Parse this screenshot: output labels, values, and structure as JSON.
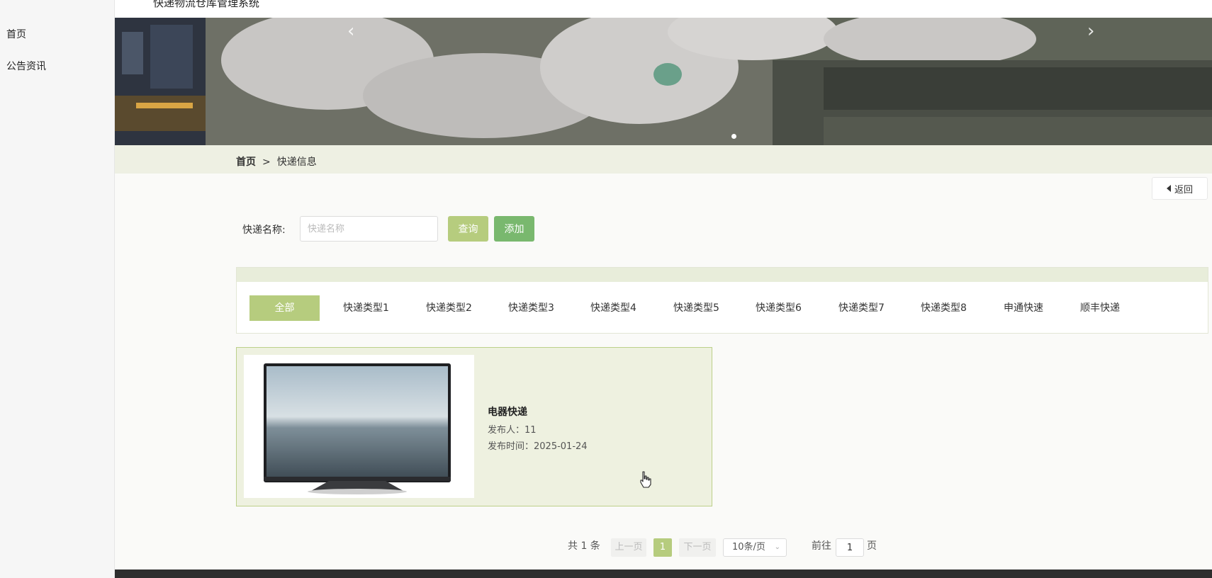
{
  "app": {
    "title": "快递物流仓库管理系统"
  },
  "sidebar": {
    "items": [
      {
        "label": "首页"
      },
      {
        "label": "公告资讯"
      }
    ]
  },
  "banner": {
    "prev_icon": "chevron-left-icon",
    "next_icon": "chevron-right-icon",
    "prev_glyph": "‹",
    "next_glyph": "›"
  },
  "breadcrumb": {
    "home": "首页",
    "separator": ">",
    "current": "快递信息"
  },
  "back_button": {
    "label": "返回",
    "icon": "caret-left-icon"
  },
  "search": {
    "label": "快递名称:",
    "placeholder": "快递名称",
    "value": "",
    "query_label": "查询",
    "add_label": "添加"
  },
  "categories": [
    {
      "label": "全部",
      "active": true
    },
    {
      "label": "快递类型1"
    },
    {
      "label": "快递类型2"
    },
    {
      "label": "快递类型3"
    },
    {
      "label": "快递类型4"
    },
    {
      "label": "快递类型5"
    },
    {
      "label": "快递类型6"
    },
    {
      "label": "快递类型7"
    },
    {
      "label": "快递类型8"
    },
    {
      "label": "申通快速"
    },
    {
      "label": "顺丰快递"
    }
  ],
  "items": [
    {
      "title": "电器快递",
      "publisher": "发布人：11",
      "publish_time": "发布时间：2025-01-24",
      "image": "television-image"
    }
  ],
  "pagination": {
    "total": "共 1 条",
    "prev": "上一页",
    "current": "1",
    "next": "下一页",
    "page_size": "10条/页",
    "goto_label": "前往",
    "goto_value": "1",
    "goto_suffix": "页"
  },
  "colors": {
    "accent": "#b6cc7e",
    "add_button": "#79b86e",
    "breadcrumb_bg": "#eef0e3",
    "card_bg": "#eef1e0",
    "card_border": "#bcd08a"
  }
}
